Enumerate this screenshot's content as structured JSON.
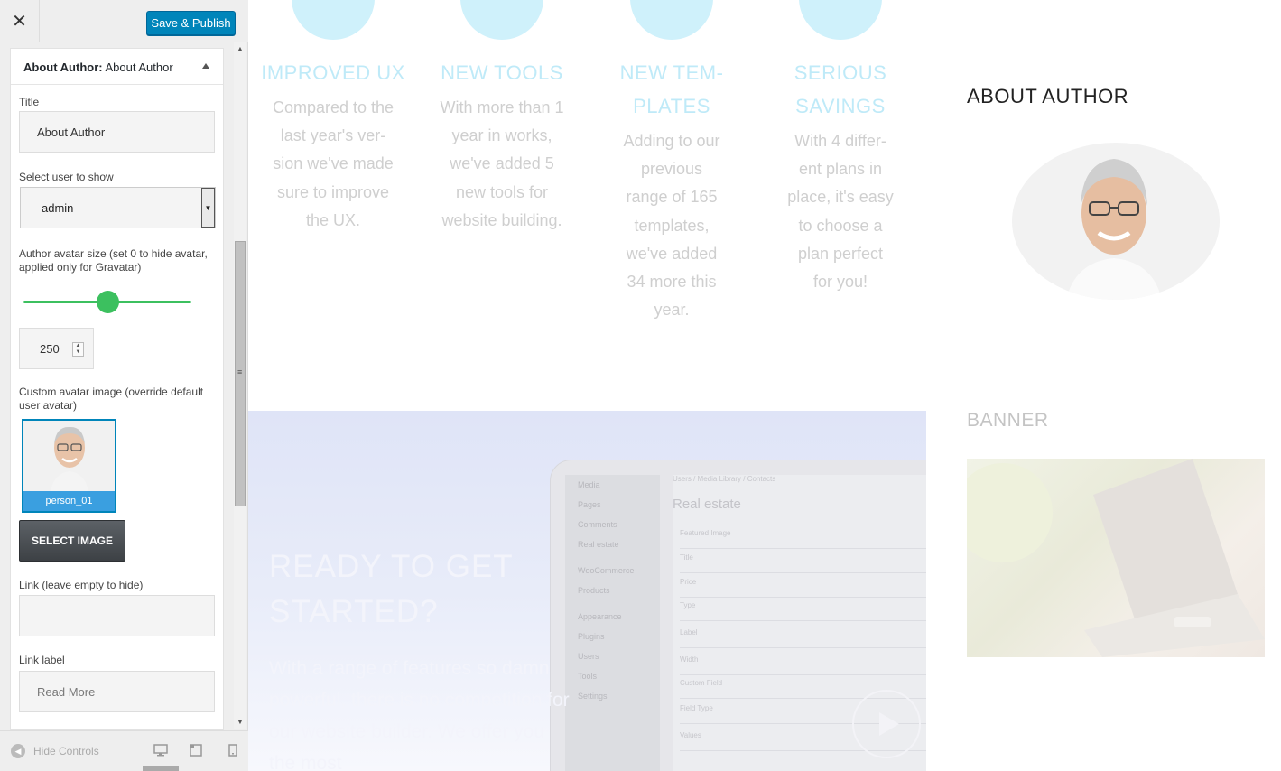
{
  "header": {
    "close_icon": "close-icon",
    "publish_label": "Save & Publish"
  },
  "panel": {
    "title_prefix": "About Author:",
    "title_name": "About Author",
    "fields": {
      "title_label": "Title",
      "title_value": "About Author",
      "user_label": "Select user to show",
      "user_value": "admin",
      "avatar_size_label": "Author avatar size (set 0 to hide avatar, applied only for Gravatar)",
      "avatar_size_value": "250",
      "custom_avatar_label": "Custom avatar image (override default user avatar)",
      "image_caption": "person_01",
      "select_image_label": "SELECT IMAGE",
      "link_label": "Link (leave empty to hide)",
      "link_value": "",
      "link_label_label": "Link label",
      "link_label_placeholder": "Read More"
    }
  },
  "footer": {
    "hide_controls": "Hide Controls"
  },
  "features": [
    {
      "title": "IMPROVED UX",
      "body": [
        "Compared to the",
        "last year's ver-",
        "sion we've made",
        "sure to improve",
        "the UX."
      ]
    },
    {
      "title": "NEW TOOLS",
      "body": [
        "With more than 1",
        "year in works,",
        "we've added 5",
        "new tools for",
        "website building."
      ]
    },
    {
      "title_lines": [
        "NEW TEM-",
        "PLATES"
      ],
      "body": [
        "Adding to our",
        "previous",
        "range of 165",
        "templates,",
        "we've added",
        "34 more this",
        "year."
      ]
    },
    {
      "title_lines": [
        "SERIOUS",
        "SAVINGS"
      ],
      "body": [
        "With 4 differ-",
        "ent plans in",
        "place, it's easy",
        "to choose a",
        "plan perfect",
        "for you!"
      ]
    }
  ],
  "cta": {
    "title_lines": [
      "READY TO GET",
      "STARTED?"
    ],
    "body": "With a range of features so damn powerful, there is no competition for our website builder. We offer you the most"
  },
  "mockup": {
    "menu": [
      "Media",
      "Pages",
      "Comments",
      "Real estate",
      "WooCommerce",
      "Products",
      "Appearance",
      "Plugins",
      "Users",
      "Tools",
      "Settings"
    ],
    "breadcrumb": "Users  /  Media Library  /  Contacts",
    "heading": "Real estate",
    "rows": [
      "Featured Image",
      "Title",
      "Price",
      "Type",
      "Label",
      "Width",
      "Custom Field",
      "Field Type",
      "Values"
    ]
  },
  "widgets": {
    "about_title": "ABOUT AUTHOR",
    "banner_title": "BANNER"
  },
  "colors": {
    "accent": "#0085ba",
    "slider": "#3cc05f",
    "feature_title": "#bfeaf8"
  },
  "slider_fraction": 0.5
}
